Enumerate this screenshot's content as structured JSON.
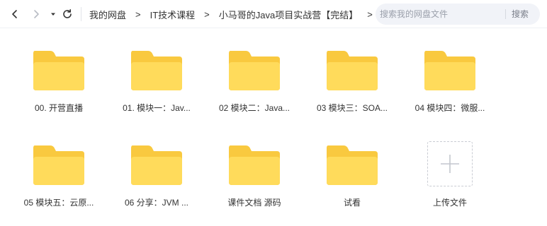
{
  "toolbar": {
    "back_icon": "chevron-left-icon",
    "forward_icon": "chevron-right-icon",
    "history_icon": "caret-down-icon",
    "refresh_icon": "refresh-icon"
  },
  "breadcrumb": {
    "items": [
      "我的网盘",
      "IT技术课程",
      "小马哥的Java项目实战营【完结】"
    ],
    "separator": ">"
  },
  "search": {
    "placeholder": "搜索我的网盘文件",
    "button_label": "搜索"
  },
  "colors": {
    "folder_back": "#F9C93F",
    "folder_front": "#FFDB5B",
    "search_bg": "#F1F3F8"
  },
  "files": {
    "row1": [
      {
        "label": "00. 开营直播",
        "icon": "folder-icon"
      },
      {
        "label": "01. 模块一：Jav...",
        "icon": "folder-icon"
      },
      {
        "label": "02 模块二：Java...",
        "icon": "folder-icon"
      },
      {
        "label": "03 模块三：SOA...",
        "icon": "folder-icon"
      },
      {
        "label": "04 模块四：微服...",
        "icon": "folder-icon"
      }
    ],
    "row2": [
      {
        "label": "05 模块五：云原...",
        "icon": "folder-icon"
      },
      {
        "label": "06 分享：JVM ...",
        "icon": "folder-icon"
      },
      {
        "label": "课件文档 源码",
        "icon": "folder-icon"
      },
      {
        "label": "试看",
        "icon": "folder-icon"
      }
    ],
    "upload": {
      "label": "上传文件",
      "icon": "plus-icon"
    }
  }
}
